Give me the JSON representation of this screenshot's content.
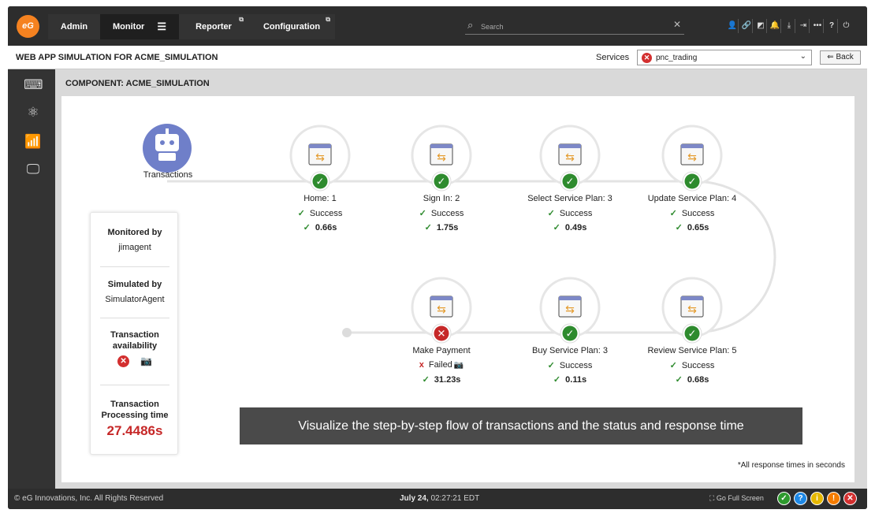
{
  "topbar": {
    "logo_text": "eG",
    "tabs": [
      {
        "label": "Admin"
      },
      {
        "label": "Monitor"
      },
      {
        "label": "Reporter"
      },
      {
        "label": "Configuration"
      }
    ],
    "search": {
      "placeholder": "Search",
      "value": ""
    },
    "icons": [
      "user-icon",
      "link-icon",
      "chart-icon",
      "bell-icon",
      "download-icon",
      "login-icon",
      "more-icon",
      "help-icon",
      "power-icon"
    ]
  },
  "header": {
    "title": "WEB APP SIMULATION FOR ACME_SIMULATION",
    "services_label": "Services",
    "services_value": "pnc_trading",
    "back_label": "Back"
  },
  "main": {
    "component_title": "COMPONENT: ACME_SIMULATION",
    "robot_label": "Transactions",
    "info": {
      "monitored_label": "Monitored by",
      "monitored_value": "jimagent",
      "simulated_label": "Simulated by",
      "simulated_value": "SimulatorAgent",
      "availability_label": "Transaction availability",
      "processing_label": "Transaction Processing time",
      "processing_value": "27.4486s"
    },
    "steps": [
      {
        "name": "Home: 1",
        "status": "Success",
        "time": "0.66s",
        "ok": true
      },
      {
        "name": "Sign In: 2",
        "status": "Success",
        "time": "1.75s",
        "ok": true
      },
      {
        "name": "Select Service Plan: 3",
        "status": "Success",
        "time": "0.49s",
        "ok": true
      },
      {
        "name": "Update Service Plan: 4",
        "status": "Success",
        "time": "0.65s",
        "ok": true
      },
      {
        "name": "Review Service Plan: 5",
        "status": "Success",
        "time": "0.68s",
        "ok": true
      },
      {
        "name": "Buy Service Plan: 3",
        "status": "Success",
        "time": "0.11s",
        "ok": true
      },
      {
        "name": "Make Payment",
        "status": "Failed",
        "time": "31.23s",
        "ok": false
      }
    ],
    "banner": "Visualize the step-by-step flow of transactions and the status and response time",
    "footnote": "*All response times in seconds"
  },
  "footer": {
    "copyright": "© eG Innovations, Inc. All Rights Reserved",
    "date": "July 24,",
    "time": "02:27:21 EDT",
    "fullscreen": "Go Full Screen"
  },
  "colors": {
    "success": "#2e8b2e",
    "failure": "#c62828",
    "accent": "#f58220",
    "robot": "#6f7fc9"
  }
}
